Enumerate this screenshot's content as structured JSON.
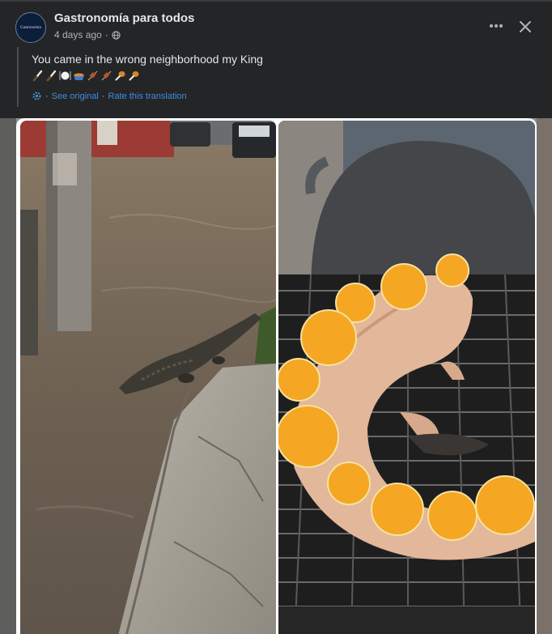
{
  "post": {
    "page_name": "Gastronomía para todos",
    "timestamp": "4 days ago",
    "separator": "·",
    "avatar_text": "Gastronomia",
    "caption": "You came in the wrong neighborhood my King",
    "emojis": [
      "knife-icon",
      "knife-icon",
      "plate-cutlery-icon",
      "pot-of-food-icon",
      "meat-skewer-icon",
      "meat-skewer-icon",
      "poultry-leg-icon",
      "poultry-leg-icon"
    ],
    "translation": {
      "see_original": "See original",
      "separator": "·",
      "rate": "Rate this translation"
    }
  },
  "icons": {
    "more": "more-options-icon",
    "close": "close-icon",
    "globe": "globe-icon",
    "gear": "gear-icon"
  },
  "colors": {
    "background": "#242526",
    "text": "#e4e6eb",
    "muted": "#b0b3b8",
    "link": "#3d8fe0"
  }
}
